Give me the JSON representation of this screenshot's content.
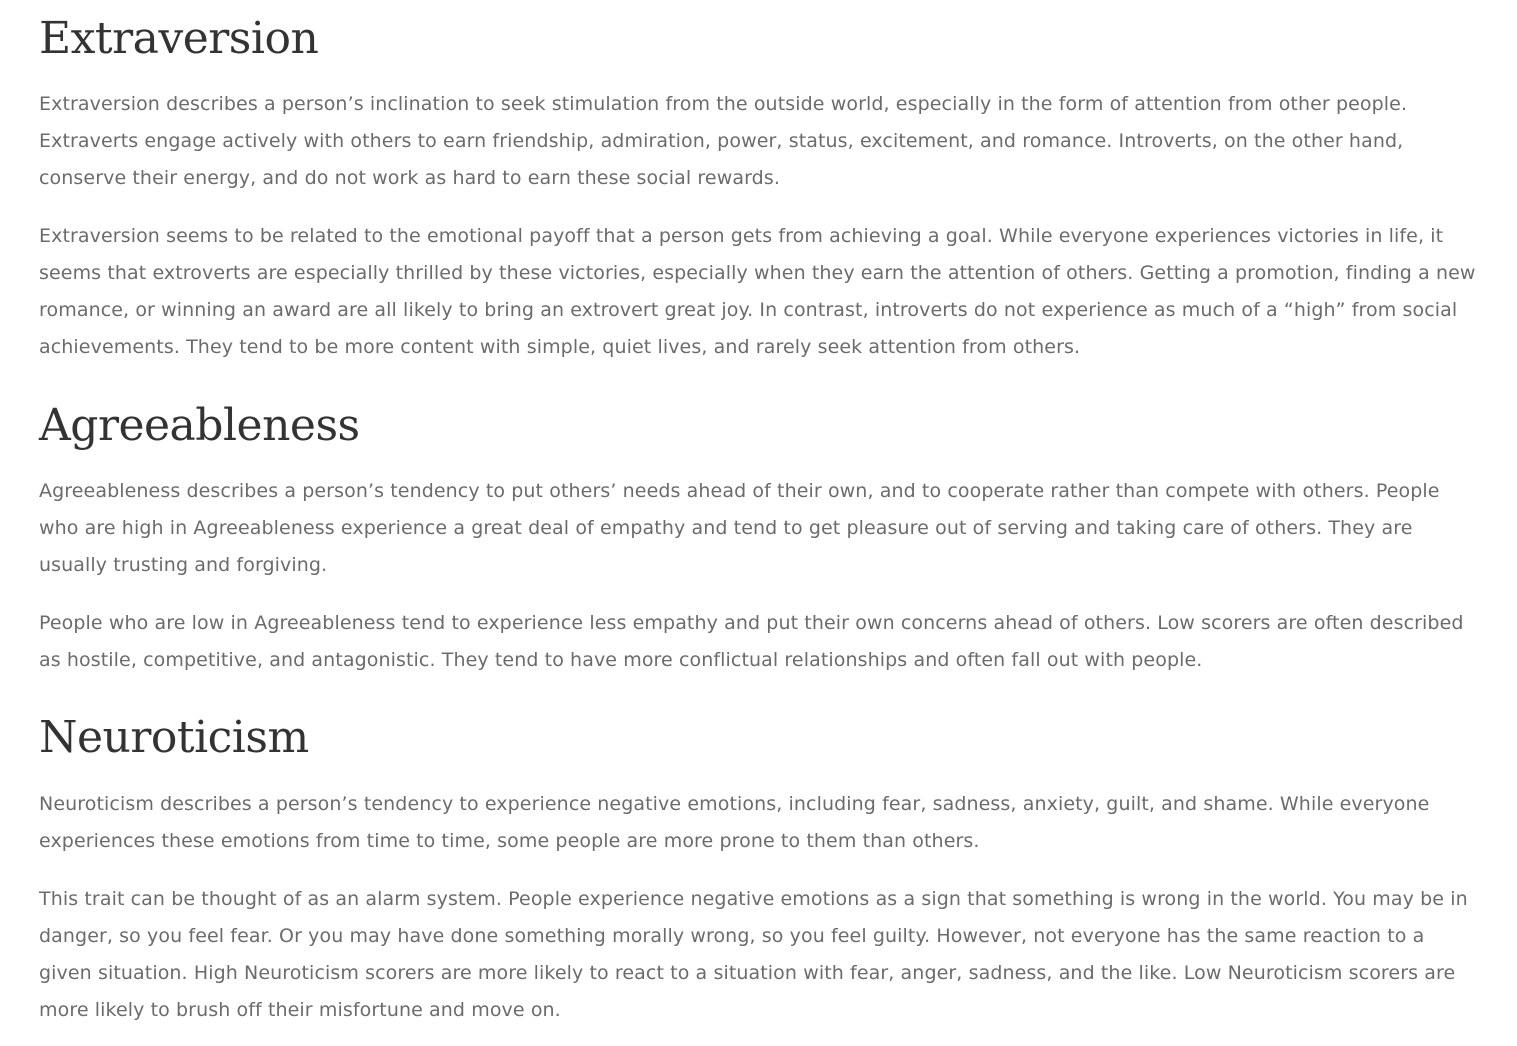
{
  "sections": [
    {
      "title": "Extraversion",
      "paragraphs": [
        "Extraversion describes a person’s inclination to seek stimulation from the outside world, especially in the form of attention from other people. Extraverts engage actively with others to earn friendship, admiration, power, status, excitement, and romance. Introverts, on the other hand, conserve their energy, and do not work as hard to earn these social rewards.",
        "Extraversion seems to be related to the emotional payoff that a person gets from achieving a goal. While everyone experiences victories in life, it seems that extroverts are especially thrilled by these victories, especially when they earn the attention of others. Getting a promotion, finding a new romance, or winning an award are all likely to bring an extrovert great joy. In contrast, introverts do not experience as much of a “high” from social achievements. They tend to be more content with simple, quiet lives, and rarely seek attention from others."
      ]
    },
    {
      "title": "Agreeableness",
      "paragraphs": [
        "Agreeableness describes a person’s tendency to put others’ needs ahead of their own, and to cooperate rather than compete with others. People who are high in Agreeableness experience a great deal of empathy and tend to get pleasure out of serving and taking care of others. They are usually trusting and forgiving.",
        "People who are low in Agreeableness tend to experience less empathy and put their own concerns ahead of others. Low scorers are often described as hostile, competitive, and antagonistic. They tend to have more conflictual relationships and often fall out with people."
      ]
    },
    {
      "title": "Neuroticism",
      "paragraphs": [
        "Neuroticism describes a person’s tendency to experience negative emotions, including fear, sadness, anxiety, guilt, and shame. While everyone experiences these emotions from time to time, some people are more prone to them than others.",
        "This trait can be thought of as an alarm system. People experience negative emotions as a sign that something is wrong in the world. You may be in danger, so you feel fear. Or you may have done something morally wrong, so you feel guilty. However, not everyone has the same reaction to a given situation. High Neuroticism scorers are more likely to react to a situation with fear, anger, sadness, and the like. Low Neuroticism scorers are more likely to brush off their misfortune and move on."
      ]
    }
  ]
}
